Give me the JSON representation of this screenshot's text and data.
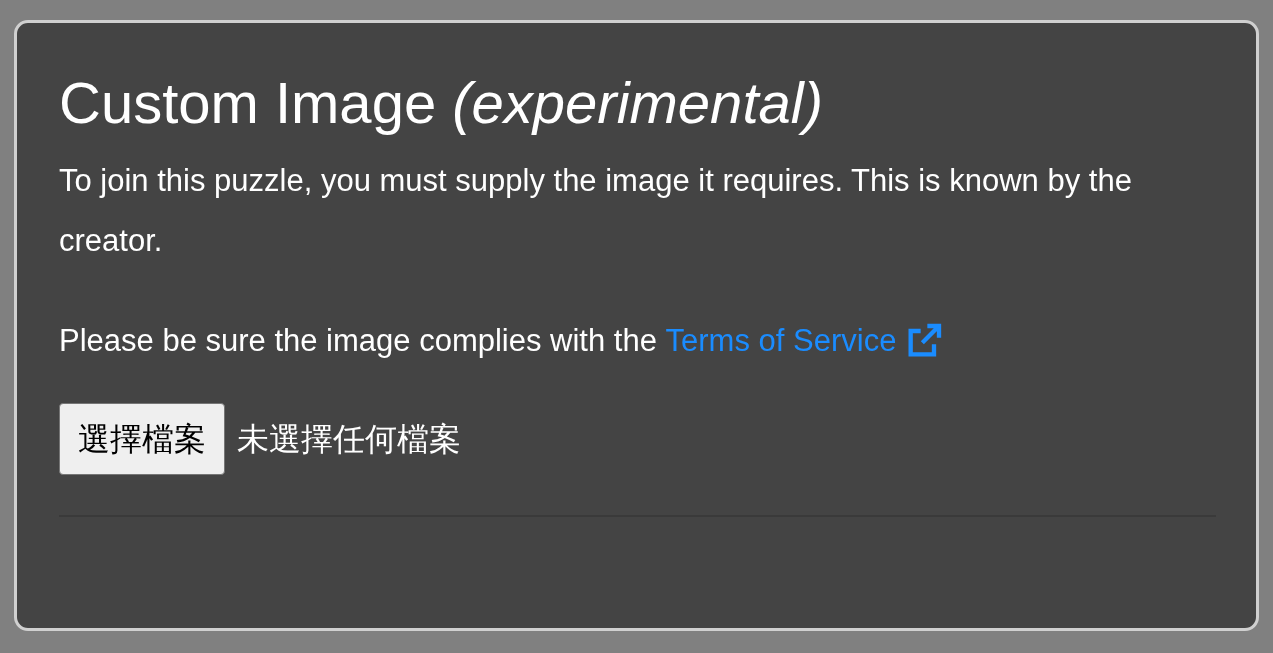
{
  "dialog": {
    "title": "Custom Image *(experimental)*",
    "description": "To join this puzzle, you must supply the image it requires. This is known by the creator.",
    "notice": {
      "text": "Please be sure the image complies with the ",
      "link": "Terms of Service"
    },
    "file_input": {
      "button": "選擇檔案",
      "status": "未選擇任何檔案"
    }
  }
}
